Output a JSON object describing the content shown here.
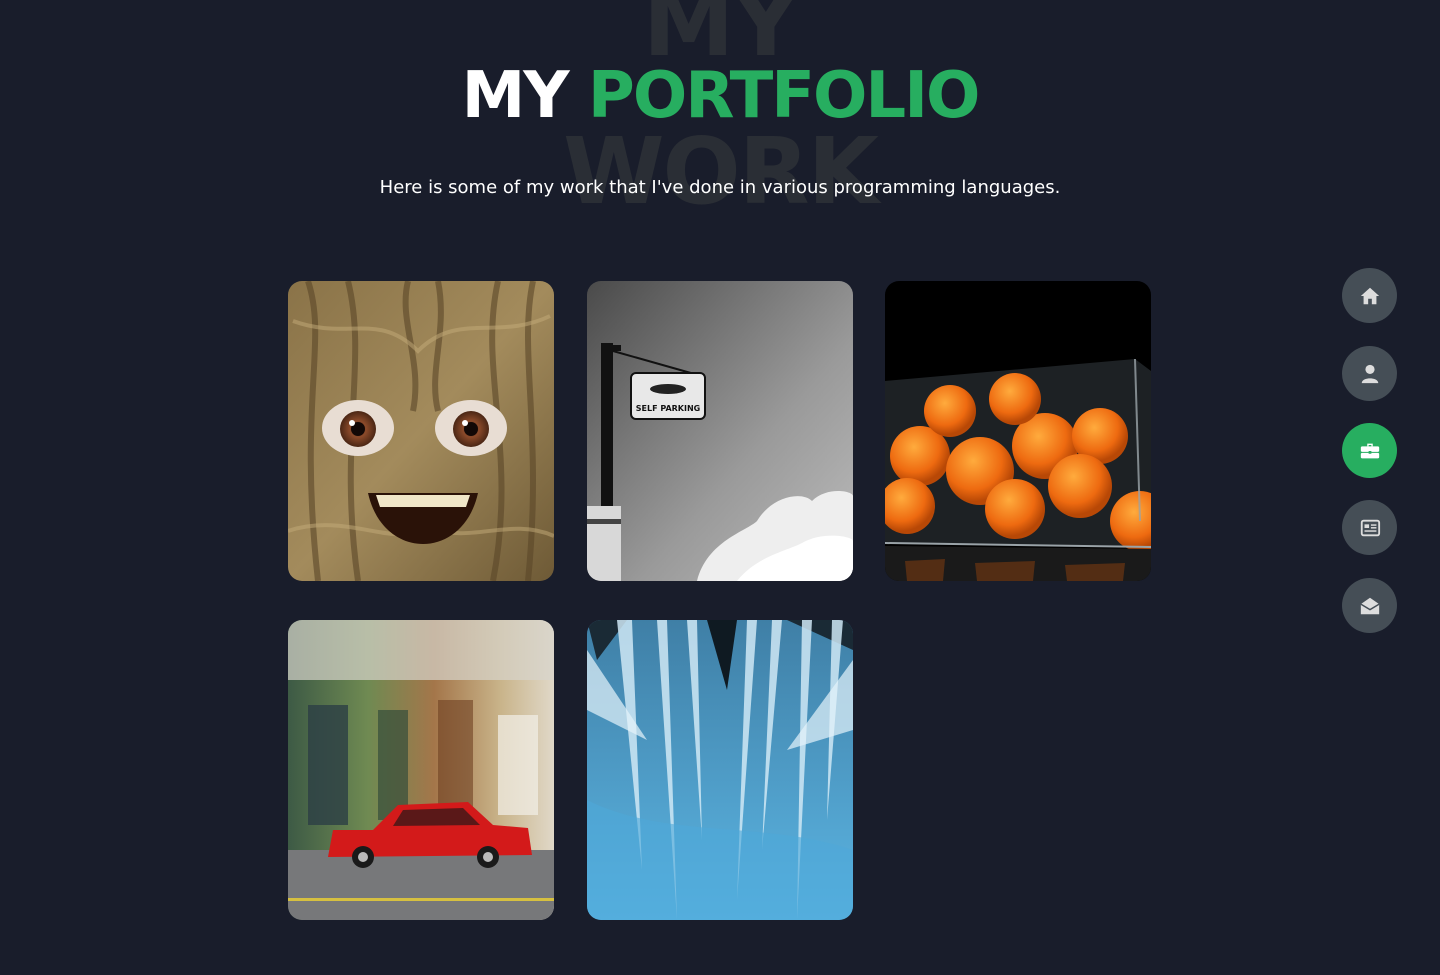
{
  "heading": {
    "background_top": "MY",
    "background_bottom": "WORK",
    "title_main": "MY",
    "title_accent": "PORTFOLIO",
    "subtitle": "Here is some of my work that I've done in various programming languages."
  },
  "portfolio": {
    "items": [
      {
        "image": "tree-bark-face-photo"
      },
      {
        "image": "self-parking-sign-photo"
      },
      {
        "image": "oranges-in-glass-photo"
      },
      {
        "image": "red-car-motion-blur-photo"
      },
      {
        "image": "blue-ice-cave-photo"
      }
    ]
  },
  "nav": {
    "items": [
      {
        "icon": "home-icon"
      },
      {
        "icon": "user-icon"
      },
      {
        "icon": "briefcase-icon",
        "active": true
      },
      {
        "icon": "newspaper-icon"
      },
      {
        "icon": "envelope-open-icon"
      }
    ]
  },
  "colors": {
    "background": "#191d2b",
    "accent": "#27ae60",
    "nav_button": "#454e56",
    "text": "#ffffff",
    "background_text": "#2a2e35"
  }
}
